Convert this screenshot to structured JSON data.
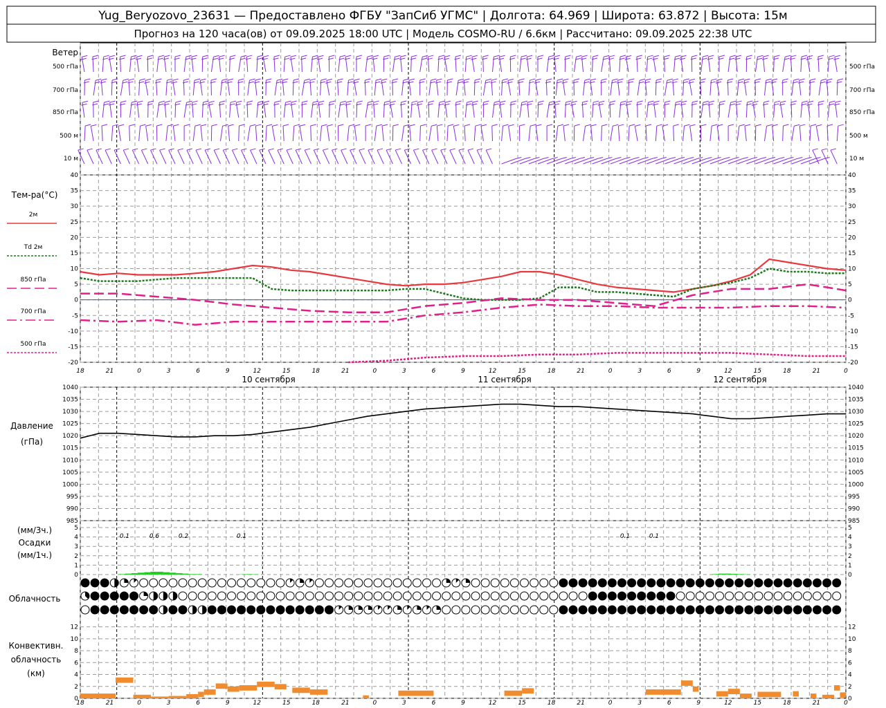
{
  "header": {
    "line1": "Yug_Beryozovo_23631 — Предоставлено ФГБУ \"ЗапСиб УГМС\" | Долгота: 64.969 | Широта: 63.872 | Высота: 15м",
    "line2": "Прогноз на 120 часа(ов) от 09.09.2025 18:00 UTC | Модель COSMO-RU / 6.6км | Рассчитано: 09.09.2025 22:38 UTC"
  },
  "time_axis": {
    "hour_labels": [
      "18",
      "21",
      "0",
      "3",
      "6",
      "9",
      "12",
      "15",
      "18",
      "21",
      "0",
      "3",
      "6",
      "9",
      "12",
      "15",
      "18",
      "21",
      "0",
      "3",
      "6",
      "9",
      "12",
      "15",
      "18",
      "21",
      "0"
    ],
    "day_labels": [
      "10 сентября",
      "11 сентября",
      "12 сентября"
    ]
  },
  "wind_panel": {
    "title": "Ветер",
    "levels": [
      "500 гПа",
      "700 гПа",
      "850 гПа",
      "500 м",
      "10 м"
    ],
    "barb_color": "#8a2be2"
  },
  "temp_panel": {
    "title": "Тем-ра(°C)",
    "legend": [
      {
        "label": "2м",
        "color": "#e8383d",
        "style": "solid"
      },
      {
        "label": "Td 2м",
        "color": "#1a7a1a",
        "style": "dotted"
      },
      {
        "label": "850 гПа",
        "color": "#e0208a",
        "style": "dashed"
      },
      {
        "label": "700 гПа",
        "color": "#e0208a",
        "style": "dashdot"
      },
      {
        "label": "500 гПа",
        "color": "#e0208a",
        "style": "dotted"
      }
    ],
    "yticks": [
      "40",
      "35",
      "30",
      "25",
      "20",
      "15",
      "10",
      "5",
      "0",
      "-5",
      "-10",
      "-15",
      "-20"
    ]
  },
  "pressure_panel": {
    "title": "Давление",
    "unit": "(гПа)",
    "yticks": [
      "1040",
      "1035",
      "1030",
      "1025",
      "1020",
      "1015",
      "1010",
      "1005",
      "1000",
      "995",
      "990",
      "985"
    ]
  },
  "precip_panel": {
    "unit_top": "(мм/3ч.)",
    "title": "Осадки",
    "unit_bottom": "(мм/1ч.)",
    "yticks": [
      "5",
      "4",
      "3",
      "2",
      "1",
      "0"
    ],
    "amount_labels": [
      "0.1",
      "0.6",
      "0.2",
      "0.1",
      "0.1",
      "0.1"
    ]
  },
  "cloud_panel": {
    "title": "Облачность"
  },
  "conv_panel": {
    "title_lines": [
      "Конвективн.",
      "облачность",
      "(км)"
    ],
    "yticks": [
      "12",
      "10",
      "8",
      "6",
      "4",
      "2",
      "0"
    ],
    "bar_color": "#f08c2e"
  },
  "chart_data": [
    {
      "type": "line",
      "title": "Тем-ра(°C)",
      "x_unit": "hours from 09.09.2025 18:00 UTC",
      "ylim": [
        -20,
        40
      ],
      "grid": true,
      "series": [
        {
          "name": "2м",
          "x": [
            0,
            3,
            6,
            9,
            12,
            15,
            18,
            21,
            24,
            27,
            30,
            33,
            36,
            39,
            42,
            45,
            48,
            51,
            54,
            57,
            60,
            63,
            66,
            69,
            72,
            75,
            78,
            81,
            84,
            87,
            90,
            93,
            96,
            99,
            102,
            105,
            108,
            111,
            114,
            117,
            120
          ],
          "values": [
            9,
            8,
            8.5,
            8,
            8,
            8,
            8.5,
            9,
            10,
            11,
            10.5,
            9.5,
            9,
            8,
            7,
            6,
            5,
            4.5,
            5,
            5,
            5.5,
            6.5,
            7.5,
            9,
            9,
            8,
            6.5,
            5,
            4,
            3.5,
            3,
            2.5,
            3.5,
            4.5,
            6,
            8,
            13,
            12,
            11,
            10,
            9.5
          ]
        },
        {
          "name": "Td 2м",
          "x": [
            0,
            3,
            6,
            9,
            12,
            15,
            18,
            21,
            24,
            27,
            30,
            33,
            36,
            39,
            42,
            45,
            48,
            51,
            54,
            57,
            60,
            63,
            66,
            69,
            72,
            75,
            78,
            81,
            84,
            87,
            90,
            93,
            96,
            99,
            102,
            105,
            108,
            111,
            114,
            117,
            120
          ],
          "values": [
            7,
            6,
            6,
            6,
            6.5,
            7,
            7,
            7,
            7,
            7,
            3.5,
            3,
            3,
            3,
            3,
            3,
            3,
            3.5,
            3.5,
            2,
            0.5,
            0,
            0,
            0,
            0.5,
            4,
            4,
            2.5,
            2.5,
            2,
            1.5,
            1,
            3.5,
            4.5,
            5.5,
            7,
            10,
            9,
            9,
            8.5,
            8.5
          ]
        },
        {
          "name": "850 гПа",
          "x": [
            0,
            6,
            12,
            18,
            24,
            30,
            36,
            42,
            48,
            54,
            60,
            66,
            72,
            78,
            84,
            90,
            96,
            102,
            108,
            114,
            120
          ],
          "values": [
            2,
            2,
            1,
            0,
            -1.5,
            -2.5,
            -3.5,
            -4,
            -4,
            -2,
            -1,
            0.5,
            0,
            0,
            -1,
            -2,
            1.5,
            3.5,
            3.5,
            5,
            3
          ]
        },
        {
          "name": "700 гПа",
          "x": [
            0,
            6,
            12,
            18,
            24,
            30,
            36,
            42,
            48,
            54,
            60,
            66,
            72,
            78,
            84,
            90,
            96,
            102,
            108,
            114,
            120
          ],
          "values": [
            -6.5,
            -7,
            -6.5,
            -8,
            -7,
            -7,
            -7,
            -7,
            -7,
            -5,
            -4,
            -2.5,
            -1.5,
            -2,
            -2,
            -2.5,
            -2.5,
            -2.5,
            -2,
            -2,
            -2.5
          ]
        },
        {
          "name": "500 гПа",
          "x": [
            42,
            48,
            54,
            60,
            66,
            72,
            78,
            84,
            90,
            96,
            102,
            108,
            114,
            120
          ],
          "values": [
            -20,
            -19.5,
            -18.5,
            -18,
            -18,
            -17.5,
            -17.5,
            -17,
            -17,
            -17,
            -17,
            -17.5,
            -18,
            -18
          ]
        }
      ]
    },
    {
      "type": "line",
      "title": "Давление",
      "ylabel": "(гПа)",
      "ylim": [
        985,
        1040
      ],
      "grid": true,
      "series": [
        {
          "name": "Давление",
          "x": [
            0,
            3,
            6,
            9,
            12,
            15,
            18,
            21,
            24,
            27,
            30,
            33,
            36,
            39,
            42,
            45,
            48,
            51,
            54,
            57,
            60,
            63,
            66,
            69,
            72,
            75,
            78,
            81,
            84,
            87,
            90,
            93,
            96,
            99,
            102,
            105,
            108,
            111,
            114,
            117,
            120
          ],
          "values": [
            1019,
            1021,
            1021,
            1020.5,
            1020,
            1019.5,
            1019.5,
            1020,
            1020,
            1020.5,
            1021.5,
            1022.5,
            1023.5,
            1025,
            1026.5,
            1028,
            1029,
            1030,
            1031,
            1031.5,
            1032,
            1032.5,
            1033,
            1033,
            1032.5,
            1032,
            1032,
            1031.5,
            1031,
            1030.5,
            1030,
            1029.5,
            1029,
            1028,
            1027,
            1027,
            1027.5,
            1028,
            1028.5,
            1029,
            1029
          ]
        }
      ]
    },
    {
      "type": "bar",
      "title": "Осадки",
      "ylabel": "(мм/1ч.)",
      "ylim": [
        0,
        5
      ],
      "x": [
        6,
        7,
        8,
        9,
        10,
        11,
        12,
        13,
        14,
        15,
        16,
        17,
        18,
        25,
        26,
        27,
        99,
        100,
        101,
        102,
        103,
        104
      ],
      "values": [
        0.05,
        0.1,
        0.15,
        0.2,
        0.25,
        0.3,
        0.3,
        0.25,
        0.2,
        0.15,
        0.1,
        0.05,
        0.05,
        0.03,
        0.05,
        0.03,
        0.05,
        0.1,
        0.1,
        0.08,
        0.05,
        0.03
      ],
      "color": "#22cc22"
    },
    {
      "type": "bar",
      "title": "Конвективн. облачность (км)",
      "ylim": [
        0,
        13
      ],
      "segments": [
        {
          "x0": 0,
          "x1": 6,
          "value": 0.8
        },
        {
          "x0": 6,
          "x1": 9,
          "value": 3.5
        },
        {
          "x0": 9,
          "x1": 12,
          "value": 0.6
        },
        {
          "x0": 12,
          "x1": 15,
          "value": 0.3
        },
        {
          "x0": 15,
          "x1": 18,
          "value": 0.4
        },
        {
          "x0": 18,
          "x1": 20,
          "value": 0.7
        },
        {
          "x0": 20,
          "x1": 21,
          "value": 1.1
        },
        {
          "x0": 21,
          "x1": 23,
          "value": 1.5
        },
        {
          "x0": 23,
          "x1": 25,
          "value": 2.5
        },
        {
          "x0": 25,
          "x1": 27,
          "value": 2.0
        },
        {
          "x0": 27,
          "x1": 30,
          "value": 2.2
        },
        {
          "x0": 30,
          "x1": 33,
          "value": 2.8
        },
        {
          "x0": 33,
          "x1": 35,
          "value": 2.4
        },
        {
          "x0": 36,
          "x1": 39,
          "value": 1.8
        },
        {
          "x0": 39,
          "x1": 42,
          "value": 1.5
        },
        {
          "x0": 48,
          "x1": 49,
          "value": 0.5
        },
        {
          "x0": 54,
          "x1": 60,
          "value": 1.3
        },
        {
          "x0": 72,
          "x1": 75,
          "value": 1.3
        },
        {
          "x0": 75,
          "x1": 77,
          "value": 1.7
        },
        {
          "x0": 96,
          "x1": 102,
          "value": 1.5
        },
        {
          "x0": 102,
          "x1": 104,
          "value": 3.0
        },
        {
          "x0": 104,
          "x1": 105,
          "value": 2.0
        },
        {
          "x0": 108,
          "x1": 110,
          "value": 1.2
        },
        {
          "x0": 110,
          "x1": 112,
          "value": 1.6
        },
        {
          "x0": 112,
          "x1": 114,
          "value": 0.8
        },
        {
          "x0": 115,
          "x1": 119,
          "value": 1.1
        },
        {
          "x0": 121,
          "x1": 122,
          "value": 1.2
        },
        {
          "x0": 124,
          "x1": 125,
          "value": 0.8
        },
        {
          "x0": 126,
          "x1": 128,
          "value": 0.6
        },
        {
          "x0": 128,
          "x1": 129,
          "value": 2.2
        },
        {
          "x0": 129,
          "x1": 130,
          "value": 1.0
        }
      ]
    },
    {
      "type": "table",
      "title": "Облачность",
      "rows": [
        "upper",
        "middle",
        "lower"
      ],
      "pattern_upper": "8888443211100000000000000000000000000000112210000000000000000000000000022112200000000000000008888888888888888888888888888888888888888888888888888888888",
      "pattern_middle": "3888888888421444440000000000000000000000000000000000000000000000000000000000000000000000000000000000888888888888888888000000000000000000000000000000000",
      "pattern_lower": "0888888888888884888844448888888888888888888888888411232321121211222112000000000000000000000000888888888888888888888888888888888888888888888888888888888"
    }
  ]
}
